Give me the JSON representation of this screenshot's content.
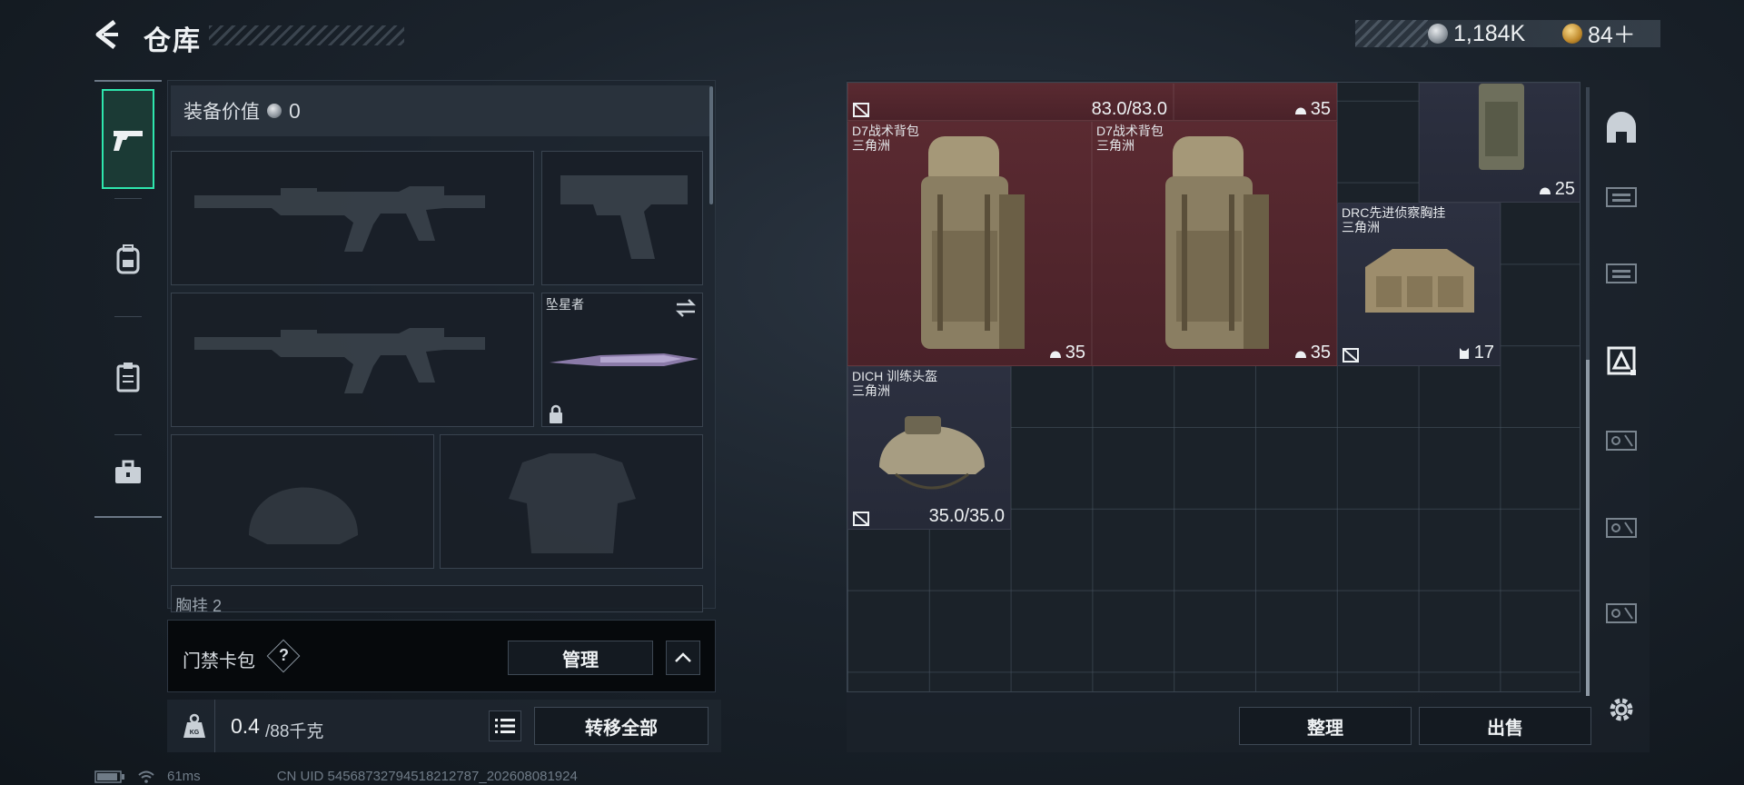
{
  "header": {
    "title": "仓库",
    "currency": [
      {
        "icon": "silver-coin-icon",
        "value": "1,184K"
      },
      {
        "icon": "gold-coin-icon",
        "value": "84＋"
      }
    ]
  },
  "rail": {
    "tabs": [
      "pistol-icon",
      "backpack-icon",
      "clipboard-icon",
      "toolbox-icon"
    ],
    "active": "pistol-icon"
  },
  "equipment": {
    "value_label": "装备价值",
    "value": "0",
    "knife_name": "坠星者",
    "next_section": "胸挂 2"
  },
  "keycard": {
    "label": "门禁卡包",
    "help": "?",
    "manage_label": "管理"
  },
  "weight": {
    "current": "0.4",
    "max": "/88千克",
    "transfer_all_label": "转移全部",
    "kg_badge": "KG"
  },
  "storage": {
    "items": [
      {
        "name": "",
        "sub": "",
        "durability": "83.0/83.0",
        "color": "red"
      },
      {
        "name": "",
        "sub": "",
        "value": "35",
        "color": "red"
      },
      {
        "name": "",
        "sub": "",
        "value": "25",
        "color": "dark"
      },
      {
        "name": "D7战术背包",
        "sub": "三角洲",
        "value": "35",
        "color": "red"
      },
      {
        "name": "D7战术背包",
        "sub": "三角洲",
        "value": "35",
        "color": "red"
      },
      {
        "name": "DRC先进侦察胸挂",
        "sub": "三角洲",
        "value": "17",
        "color": "dark"
      },
      {
        "name": "DICH 训练头盔",
        "sub": "三角洲",
        "durability": "35.0/35.0",
        "color": "dark"
      }
    ],
    "sort_label": "整理",
    "sell_label": "出售"
  },
  "side_tabs": [
    "gt-icon",
    "gti-icon",
    "iv-icon",
    "ga-icon",
    "v-icon",
    "v-icon",
    "v-icon"
  ],
  "status": {
    "ping": "61ms",
    "uid": "CN UID 5456873279451821278​7_202608081924"
  },
  "colors": {
    "accent": "#2ee6ad",
    "item_red": "#5a2a31",
    "item_dark": "#2c3040"
  }
}
